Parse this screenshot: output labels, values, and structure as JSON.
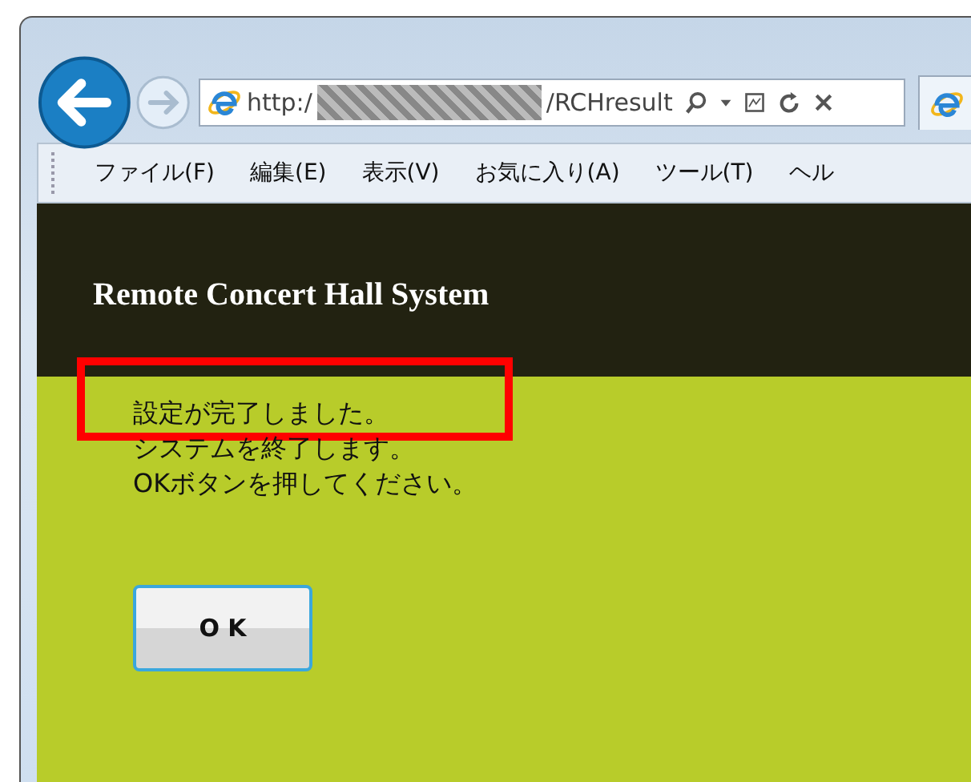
{
  "address_bar": {
    "scheme": "http:/",
    "path": "/RCHresult"
  },
  "menu_bar": [
    "ファイル(F)",
    "編集(E)",
    "表示(V)",
    "お気に入り(A)",
    "ツール(T)",
    "ヘル"
  ],
  "page": {
    "title": "Remote Concert Hall System",
    "messages": [
      {
        "text": "設定が完了しました。",
        "highlighted": true
      },
      {
        "text": "システムを終了します。",
        "highlighted": false
      },
      {
        "text": "OKボタンを押してください。",
        "highlighted": false
      }
    ],
    "button": "O K"
  }
}
